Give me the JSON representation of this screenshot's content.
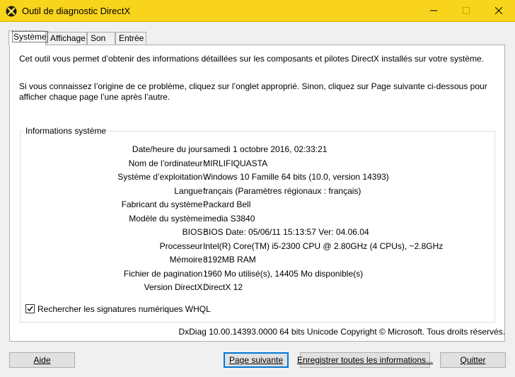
{
  "window": {
    "title": "Outil de diagnostic DirectX"
  },
  "tabs": [
    {
      "label": "Système",
      "active": true
    },
    {
      "label": "Affichage",
      "active": false
    },
    {
      "label": "Son",
      "active": false
    },
    {
      "label": "Entrée",
      "active": false
    }
  ],
  "intro": {
    "line1": "Cet outil vous permet d’obtenir des informations détaillées sur les composants et pilotes DirectX installés sur votre système.",
    "line2": "Si vous connaissez l’origine de ce problème, cliquez sur l’onglet approprié. Sinon, cliquez sur Page suivante ci-dessous pour afficher chaque page l’une après l’autre."
  },
  "system_info": {
    "title": "Informations système",
    "rows": [
      {
        "label": "Date/heure du jour :",
        "value": "samedi 1 octobre 2016, 02:33:21"
      },
      {
        "label": "Nom de l’ordinateur :",
        "value": "MIRLIFIQUASTA"
      },
      {
        "label": "Système d’exploitation :",
        "value": "Windows 10 Famille 64 bits (10.0, version 14393)"
      },
      {
        "label": "Langue :",
        "value": "français (Paramètres régionaux : français)"
      },
      {
        "label": "Fabricant du système :",
        "value": "Packard Bell"
      },
      {
        "label": "Modèle du système :",
        "value": "imedia S3840"
      },
      {
        "label": "BIOS :",
        "value": "BIOS Date: 05/06/11 15:13:57 Ver: 04.06.04"
      },
      {
        "label": "Processeur :",
        "value": "Intel(R) Core(TM) i5-2300 CPU @ 2.80GHz (4 CPUs), ~2.8GHz"
      },
      {
        "label": "Mémoire :",
        "value": "8192MB RAM"
      },
      {
        "label": "Fichier de pagination :",
        "value": "1960 Mo utilisé(s), 14405 Mo disponible(s)"
      },
      {
        "label": "Version DirectX :",
        "value": "DirectX 12"
      }
    ]
  },
  "whql": {
    "label": "Rechercher les signatures numériques WHQL",
    "checked": true
  },
  "footer": {
    "copyright": "DxDiag 10.00.14393.0000 64 bits Unicode Copyright © Microsoft. Tous droits réservés."
  },
  "buttons": {
    "help": "Aide",
    "next_page": "Page suivante",
    "save_all": "Enregistrer toutes les informations...",
    "quit": "Quitter"
  }
}
